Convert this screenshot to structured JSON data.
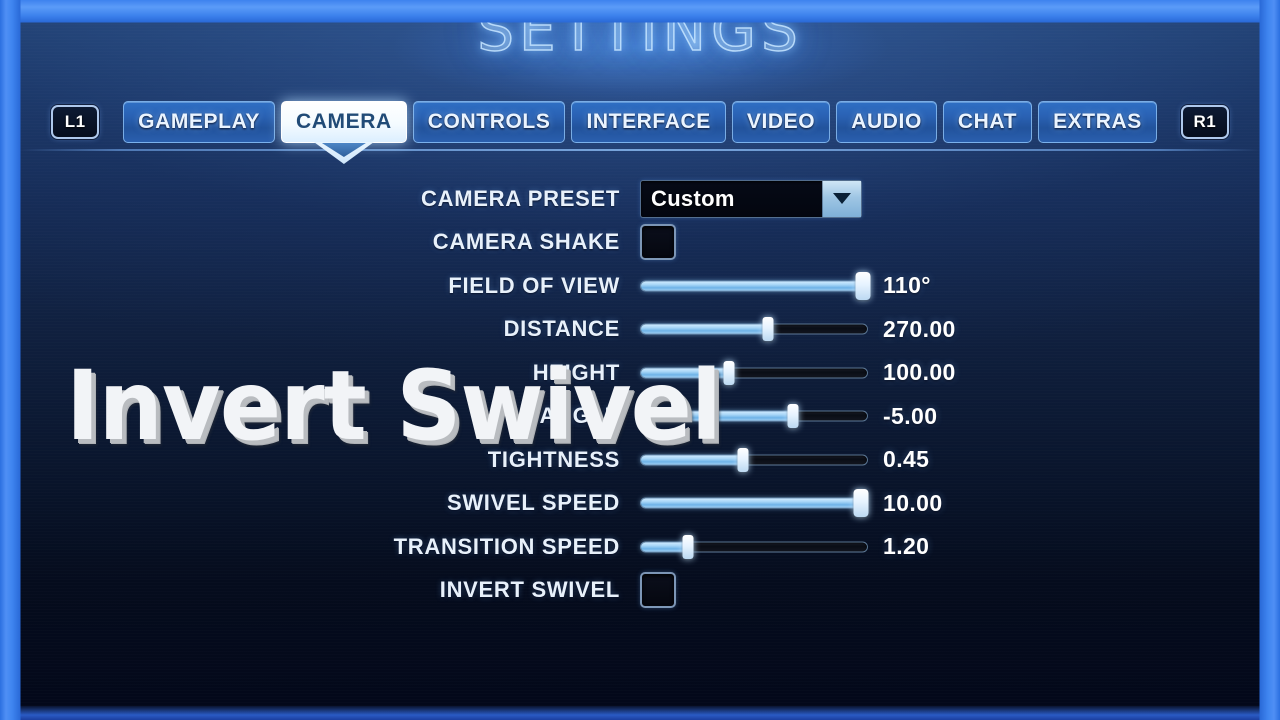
{
  "screen": {
    "title": "SETTINGS",
    "overlay_caption": "Invert Swivel",
    "accent_color": "#4f8ff5",
    "panel_top_color": "#21406f",
    "panel_bottom_color": "#03081a",
    "slider_fill_color": "#a8d6f7"
  },
  "tabbar": {
    "left_shoulder": "L1",
    "right_shoulder": "R1",
    "tabs": [
      {
        "label": "GAMEPLAY",
        "active": false
      },
      {
        "label": "CAMERA",
        "active": true
      },
      {
        "label": "CONTROLS",
        "active": false
      },
      {
        "label": "INTERFACE",
        "active": false
      },
      {
        "label": "VIDEO",
        "active": false
      },
      {
        "label": "AUDIO",
        "active": false
      },
      {
        "label": "CHAT",
        "active": false
      },
      {
        "label": "EXTRAS",
        "active": false
      }
    ]
  },
  "settings": {
    "rows": [
      {
        "label": "CAMERA PRESET",
        "type": "dropdown",
        "value": "Custom",
        "value_text": ""
      },
      {
        "label": "CAMERA SHAKE",
        "type": "checkbox",
        "checked": false,
        "value_text": ""
      },
      {
        "label": "FIELD OF VIEW",
        "type": "slider",
        "value_text": "110°",
        "percent": 98
      },
      {
        "label": "DISTANCE",
        "type": "slider",
        "value_text": "270.00",
        "percent": 56
      },
      {
        "label": "HEIGHT",
        "type": "slider",
        "value_text": "100.00",
        "percent": 39
      },
      {
        "label": "ANGLE",
        "type": "slider",
        "value_text": "-5.00",
        "percent": 67
      },
      {
        "label": "TIGHTNESS",
        "type": "slider",
        "value_text": "0.45",
        "percent": 45
      },
      {
        "label": "SWIVEL SPEED",
        "type": "slider",
        "value_text": "10.00",
        "percent": 97
      },
      {
        "label": "TRANSITION SPEED",
        "type": "slider",
        "value_text": "1.20",
        "percent": 21
      },
      {
        "label": "INVERT SWIVEL",
        "type": "checkbox",
        "checked": false,
        "value_text": ""
      }
    ]
  }
}
